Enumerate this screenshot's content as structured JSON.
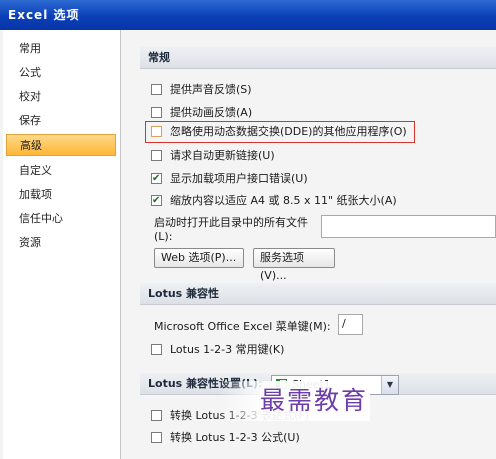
{
  "window": {
    "title": "Excel 选项"
  },
  "sidebar": {
    "items": [
      {
        "label": "常用"
      },
      {
        "label": "公式"
      },
      {
        "label": "校对"
      },
      {
        "label": "保存"
      },
      {
        "label": "高级"
      },
      {
        "label": "自定义"
      },
      {
        "label": "加载项"
      },
      {
        "label": "信任中心"
      },
      {
        "label": "资源"
      }
    ],
    "active": "高级"
  },
  "general": {
    "header": "常规",
    "options": [
      {
        "label": "提供声音反馈(S)",
        "checked": false
      },
      {
        "label": "提供动画反馈(A)",
        "checked": false
      },
      {
        "label": "忽略使用动态数据交换(DDE)的其他应用程序(O)",
        "checked": false
      },
      {
        "label": "请求自动更新链接(U)",
        "checked": false
      },
      {
        "label": "显示加载项用户接口错误(U)",
        "checked": true
      },
      {
        "label": "缩放内容以适应 A4 或 8.5 x 11\" 纸张大小(A)",
        "checked": true
      }
    ],
    "startup_label_line1": "启动时打开此目录中的所有文件",
    "startup_label_line2": "(L):",
    "startup_value": "",
    "web_options_button": "Web 选项(P)...",
    "service_options_button": "服务选项(V)..."
  },
  "lotus": {
    "header": "Lotus 兼容性",
    "menu_key_label": "Microsoft Office Excel 菜单键(M):",
    "menu_key_value": "/",
    "nav_keys_label": "Lotus 1-2-3 常用键(K)",
    "nav_keys_checked": false
  },
  "lotus_settings": {
    "header": "Lotus 兼容性设置(L):",
    "sheet": "Sheet1",
    "options": [
      {
        "label": "转换 Lotus 1-2-3 表达式(F)",
        "checked": false
      },
      {
        "label": "转换 Lotus 1-2-3 公式(U)",
        "checked": false
      }
    ]
  },
  "watermark": "最需教育"
}
